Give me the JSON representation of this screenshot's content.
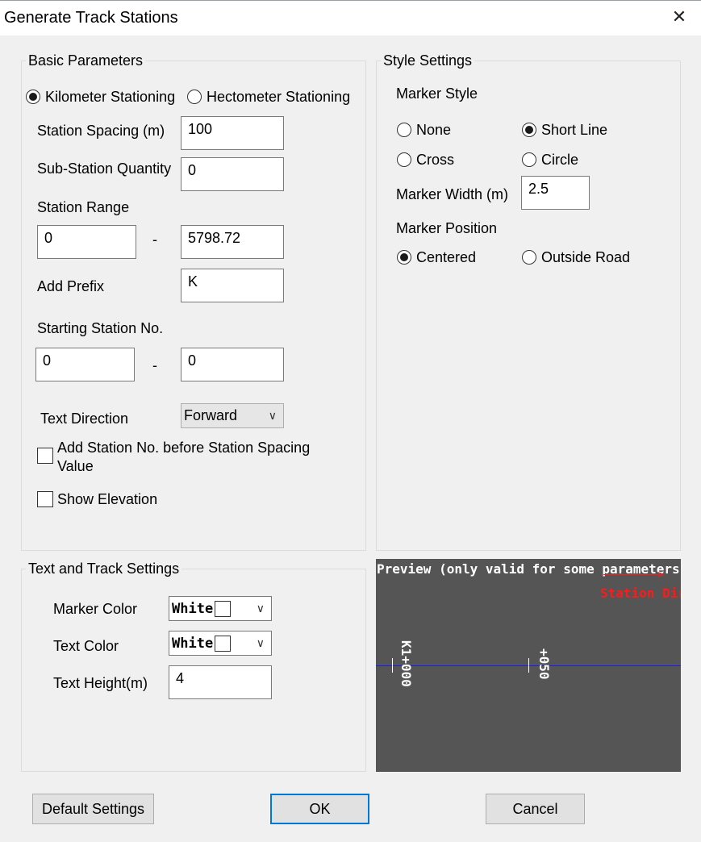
{
  "window": {
    "title": "Generate Track Stations",
    "close_icon": "close-icon"
  },
  "basic": {
    "label": "Basic Parameters",
    "radio_km": "Kilometer Stationing",
    "radio_hm": "Hectometer Stationing",
    "spacing_label": "Station Spacing (m)",
    "spacing_value": "100",
    "substation_label": "Sub-Station Quantity",
    "substation_value": "0",
    "range_label": "Station Range",
    "range_from": "0",
    "range_sep": "-",
    "range_to": "5798.72",
    "prefix_label": "Add Prefix",
    "prefix_value": "K",
    "start_label": "Starting Station No.",
    "start_a": "0",
    "start_sep": "-",
    "start_b": "0",
    "direction_label": "Text Direction",
    "direction_value": "Forward",
    "chk_add_station": "Add Station No. before Station Spacing Value",
    "chk_elevation": "Show Elevation"
  },
  "style": {
    "label": "Style Settings",
    "marker_style_label": "Marker Style",
    "opt_none": "None",
    "opt_short_line": "Short Line",
    "opt_cross": "Cross",
    "opt_circle": "Circle",
    "width_label": "Marker Width (m)",
    "width_value": "2.5",
    "position_label": "Marker Position",
    "opt_centered": "Centered",
    "opt_outside": "Outside Road"
  },
  "text_track": {
    "label": "Text and Track Settings",
    "marker_color_label": "Marker Color",
    "marker_color_value": "White",
    "text_color_label": "Text Color",
    "text_color_value": "White",
    "text_height_label": "Text Height(m)",
    "text_height_value": "4"
  },
  "preview": {
    "header": "Preview (only valid for some parameters)",
    "direction_text": "Station Direction",
    "station1": "K1+000",
    "station2": "+050"
  },
  "buttons": {
    "default": "Default Settings",
    "ok": "OK",
    "cancel": "Cancel"
  },
  "colors": {
    "preview_bg": "#555555",
    "track_line": "#1a1aff",
    "direction_text": "#ff1a1a",
    "focus_border": "#0078d7"
  }
}
